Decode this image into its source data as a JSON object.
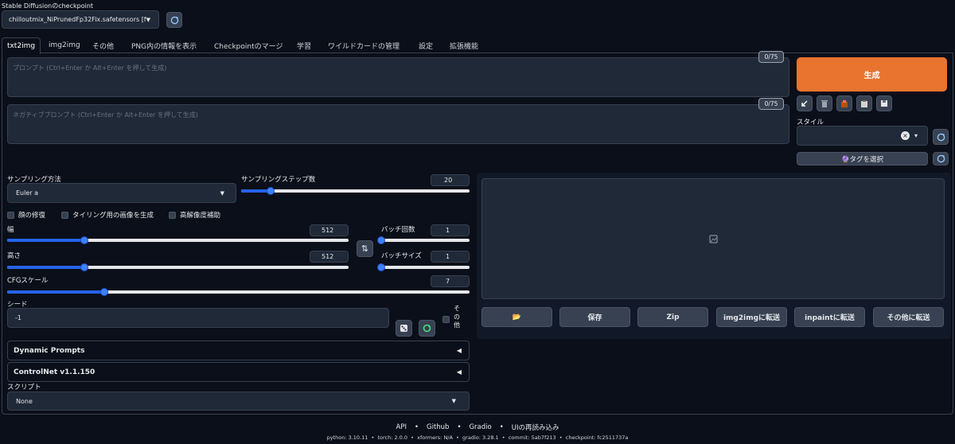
{
  "checkpoint": {
    "label": "Stable Diffusionのcheckpoint",
    "value": "chilloutmix_NiPrunedFp32Fix.safetensors [fc25",
    "refresh_icon": "refresh-icon"
  },
  "tabs": [
    "txt2img",
    "img2img",
    "その他",
    "PNG内の情報を表示",
    "Checkpointのマージ",
    "学習",
    "ワイルドカードの管理",
    "設定",
    "拡張機能"
  ],
  "active_tab": "txt2img",
  "prompt": {
    "placeholder": "プロンプト (Ctrl+Enter か Alt+Enter を押して生成)",
    "counter": "0/75"
  },
  "negative_prompt": {
    "placeholder": "ネガティブプロンプト (Ctrl+Enter か Alt+Enter を押して生成)",
    "counter": "0/75"
  },
  "generate_label": "生成",
  "tool_icons": [
    "arrow-icon",
    "trash-icon",
    "clipboard-icon",
    "paste-icon",
    "save-icon"
  ],
  "style": {
    "label": "スタイル",
    "clear": "×",
    "caret": "▾"
  },
  "tag_button": "🔮タグを選択",
  "sampling": {
    "method_label": "サンプリング方法",
    "method_value": "Euler a",
    "steps_label": "サンプリングステップ数",
    "steps_value": "20",
    "steps_fraction": 0.13
  },
  "checkboxes": [
    "顔の修復",
    "タイリング用の画像を生成",
    "高解像度補助"
  ],
  "width": {
    "label": "幅",
    "value": "512",
    "fraction": 0.226
  },
  "height": {
    "label": "高さ",
    "value": "512",
    "fraction": 0.226
  },
  "swap_icon": "swap-icon",
  "batch_count": {
    "label": "バッチ回数",
    "value": "1",
    "fraction": 0.0
  },
  "batch_size": {
    "label": "バッチサイズ",
    "value": "1",
    "fraction": 0.0
  },
  "cfg": {
    "label": "CFGスケール",
    "value": "7",
    "fraction": 0.21
  },
  "seed": {
    "label": "シード",
    "value": "-1",
    "extra_label": "その他",
    "dice_icon": "dice-icon",
    "recycle_icon": "recycle-icon"
  },
  "accordions": [
    {
      "title": "Dynamic Prompts",
      "arrow": "◀"
    },
    {
      "title": "ControlNet v1.1.150",
      "arrow": "◀"
    }
  ],
  "script": {
    "label": "スクリプト",
    "value": "None"
  },
  "output_buttons": [
    "📂",
    "保存",
    "Zip",
    "img2imgに転送",
    "inpaintに転送",
    "その他に転送"
  ],
  "footer": {
    "links": [
      "API",
      "Github",
      "Gradio",
      "UIの再読み込み"
    ],
    "separator": "•",
    "info": "python: 3.10.11  •  torch: 2.0.0  •  xformers: N/A  •  gradio: 3.28.1  •  commit: 5ab7f213  •  checkpoint: fc2511737a"
  },
  "colors": {
    "background": "#0b0f19",
    "generate": "#e8742f",
    "slider": "#2563eb"
  }
}
